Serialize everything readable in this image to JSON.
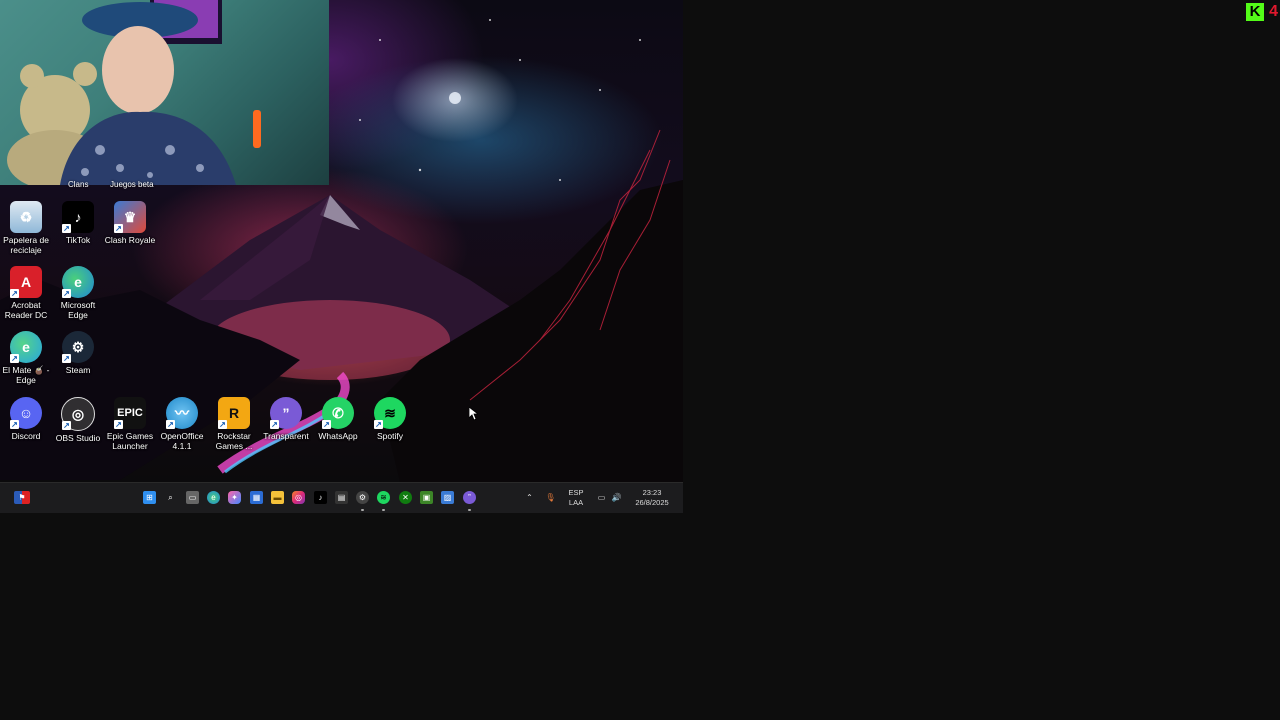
{
  "desktop_icons": [
    {
      "label": "Papelera de reciclaje",
      "icon": "recycle-bin-icon",
      "color": "#8fb8d8"
    },
    {
      "label": "TikTok",
      "icon": "tiktok-icon",
      "color": "#000000"
    },
    {
      "label": "Clash Royale",
      "icon": "clash-royale-icon",
      "color": "#3b7bd4"
    },
    {
      "label": "Acrobat Reader DC",
      "icon": "acrobat-icon",
      "color": "#d9202a"
    },
    {
      "label": "Microsoft Edge",
      "icon": "edge-icon",
      "color": "#1f86d6"
    },
    {
      "label": "El Mate 🧉 - Edge",
      "icon": "edge-profile-icon",
      "color": "#27a4e0"
    },
    {
      "label": "Steam",
      "icon": "steam-icon",
      "color": "#1b2838"
    },
    {
      "label": "Discord",
      "icon": "discord-icon",
      "color": "#5865f2"
    },
    {
      "label": "OBS Studio",
      "icon": "obs-icon",
      "color": "#302e31"
    },
    {
      "label": "Epic Games Launcher",
      "icon": "epic-games-icon",
      "color": "#111111"
    },
    {
      "label": "OpenOffice 4.1.1",
      "icon": "openoffice-icon",
      "color": "#1e88c9"
    },
    {
      "label": "Rockstar Games ...",
      "icon": "rockstar-icon",
      "color": "#f3a712"
    },
    {
      "label": "Transparent",
      "icon": "transparent-icon",
      "color": "#7a5ad6"
    },
    {
      "label": "WhatsApp",
      "icon": "whatsapp-icon",
      "color": "#25d366"
    },
    {
      "label": "Spotify",
      "icon": "spotify-icon",
      "color": "#1ed760"
    }
  ],
  "partial_labels": {
    "left": "Clans",
    "right": "Juegos beta"
  },
  "taskbar": {
    "tray": {
      "language_top": "ESP",
      "language_bottom": "LAA",
      "time": "23:23",
      "date": "26/8/2025"
    },
    "icons": [
      "windows-start-icon",
      "search-icon",
      "task-view-icon",
      "edge-icon",
      "copilot-icon",
      "store-icon",
      "file-explorer-icon",
      "instagram-icon",
      "tiktok-icon",
      "calculator-icon",
      "settings-icon",
      "spotify-icon",
      "xbox-icon",
      "minecraft-icon",
      "photos-icon",
      "transparent-icon"
    ]
  },
  "brand": {
    "logo": "kick-logo",
    "count": "4",
    "color": "#53fc18",
    "count_color": "#e0182d"
  }
}
